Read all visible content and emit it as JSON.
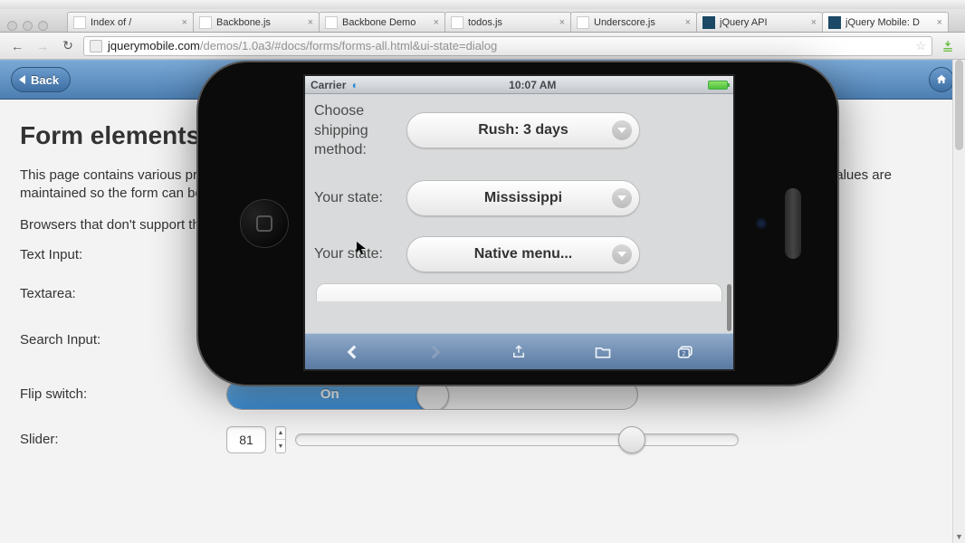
{
  "browser": {
    "tabs": [
      {
        "title": "Index of /"
      },
      {
        "title": "Backbone.js"
      },
      {
        "title": "Backbone Demo"
      },
      {
        "title": "todos.js"
      },
      {
        "title": "Underscore.js"
      },
      {
        "title": "jQuery API"
      },
      {
        "title": "jQuery Mobile: D"
      }
    ],
    "url_domain": "jquerymobile.com",
    "url_path": "/demos/1.0a3/#docs/forms/forms-all.html&ui-state=dialog"
  },
  "header": {
    "back_label": "Back"
  },
  "page": {
    "heading": "Form elements",
    "para1": "This page contains various progressive-enhancement driven form controls. Native elements are sometimes hidden from view, but their values are maintained so the form can be submitted normally.",
    "para2": "Browsers that don't support the custom controls will still deliver a usable experience, because all are based on native form elements.",
    "labels": {
      "text_input": "Text Input:",
      "textarea": "Textarea:",
      "search_input": "Search Input:",
      "flip_switch": "Flip switch:",
      "slider": "Slider:"
    },
    "flip_on": "On",
    "slider_value": "81"
  },
  "phone": {
    "carrier": "Carrier",
    "time": "10:07 AM",
    "rows": [
      {
        "label": "Choose shipping method:",
        "value": "Rush: 3 days"
      },
      {
        "label": "Your state:",
        "value": "Mississippi"
      },
      {
        "label": "Your state:",
        "value": "Native menu..."
      }
    ],
    "tabs_count": "2"
  }
}
